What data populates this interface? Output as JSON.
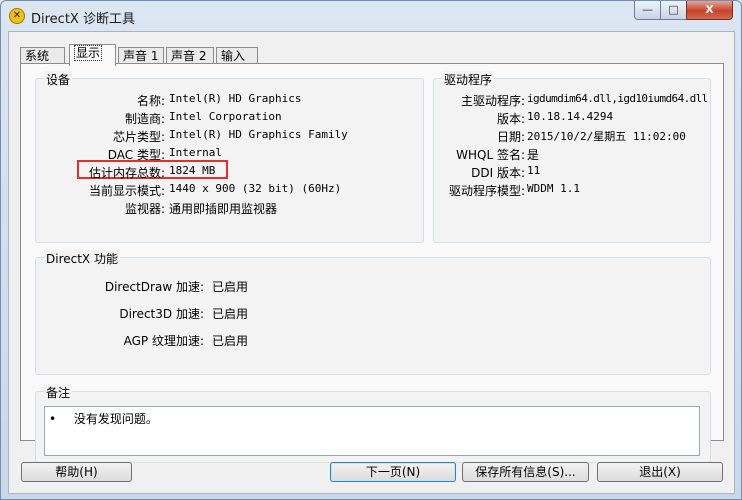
{
  "window": {
    "title": "DirectX 诊断工具",
    "icon_name": "directx-icon",
    "min_glyph": "—",
    "max_glyph": "□",
    "close_glyph": "X"
  },
  "tabs": [
    "系统",
    "显示",
    "声音 1",
    "声音 2",
    "输入"
  ],
  "active_tab": "显示",
  "device": {
    "title": "设备",
    "rows": [
      {
        "label": "名称:",
        "value": "Intel(R) HD Graphics"
      },
      {
        "label": "制造商:",
        "value": "Intel Corporation"
      },
      {
        "label": "芯片类型:",
        "value": "Intel(R) HD Graphics Family"
      },
      {
        "label": "DAC 类型:",
        "value": "Internal"
      },
      {
        "label": "估计内存总数:",
        "value": "1824 MB"
      },
      {
        "label": "当前显示模式:",
        "value": "1440 x 900 (32 bit) (60Hz)"
      },
      {
        "label": "监视器:",
        "value": "通用即插即用监视器"
      }
    ]
  },
  "driver": {
    "title": "驱动程序",
    "rows": [
      {
        "label": "主驱动程序:",
        "value": "igdumdim64.dll,igd10iumd64.dll"
      },
      {
        "label": "版本:",
        "value": "10.18.14.4294"
      },
      {
        "label": "日期:",
        "value": "2015/10/2/星期五 11:02:00"
      },
      {
        "label": "WHQL 签名:",
        "value": "是"
      },
      {
        "label": "DDI 版本:",
        "value": "11"
      },
      {
        "label": "驱动程序模型:",
        "value": "WDDM 1.1"
      }
    ]
  },
  "directx": {
    "title": "DirectX 功能",
    "rows": [
      {
        "label": "DirectDraw 加速:",
        "value": "已启用"
      },
      {
        "label": "Direct3D 加速:",
        "value": "已启用"
      },
      {
        "label": "AGP 纹理加速:",
        "value": "已启用"
      }
    ]
  },
  "notes": {
    "title": "备注",
    "bullet": "•",
    "item": "没有发现问题。"
  },
  "buttons": {
    "help": "帮助(H)",
    "next": "下一页(N)",
    "save": "保存所有信息(S)...",
    "exit": "退出(X)"
  },
  "colors": {
    "highlight": "#e0312f",
    "close_button": "#c7442b"
  }
}
